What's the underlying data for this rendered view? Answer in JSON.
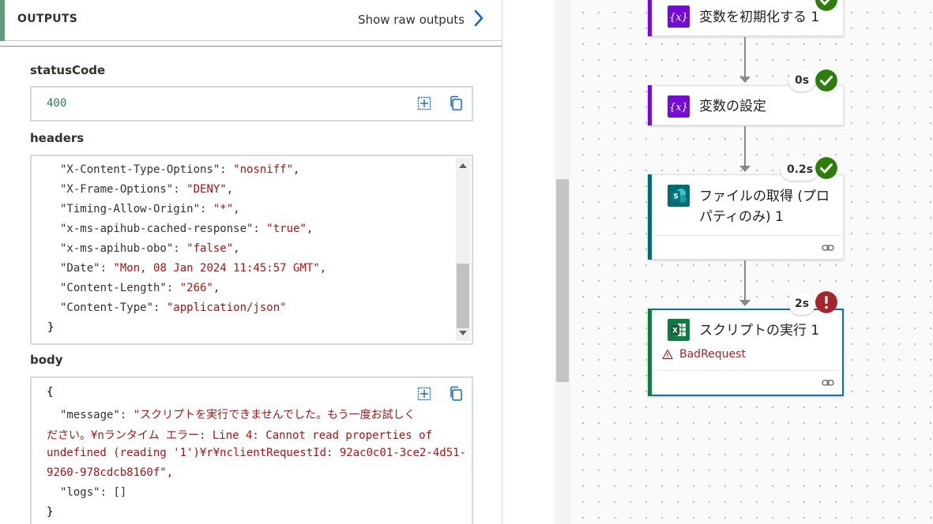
{
  "outputs": {
    "title": "OUTPUTS",
    "raw_link": "Show raw outputs"
  },
  "status_code": {
    "label": "statusCode",
    "value": "400"
  },
  "headers": {
    "label": "headers",
    "lines": [
      {
        "k": "\"X-Content-Type-Options\": ",
        "v": "\"nosniff\"",
        "t": ","
      },
      {
        "k": "\"X-Frame-Options\": ",
        "v": "\"DENY\"",
        "t": ","
      },
      {
        "k": "\"Timing-Allow-Origin\": ",
        "v": "\"*\"",
        "t": ","
      },
      {
        "k": "\"x-ms-apihub-cached-response\": ",
        "v": "\"true\"",
        "t": ","
      },
      {
        "k": "\"x-ms-apihub-obo\": ",
        "v": "\"false\"",
        "t": ","
      },
      {
        "k": "\"Date\": ",
        "v": "\"Mon, 08 Jan 2024 11:45:57 GMT\"",
        "t": ","
      },
      {
        "k": "\"Content-Length\": ",
        "v": "\"266\"",
        "t": ","
      },
      {
        "k": "\"Content-Type\": ",
        "v": "\"application/json\"",
        "t": ""
      }
    ],
    "closing": "}"
  },
  "body": {
    "label": "body",
    "open": "{",
    "message_key": "\"message\": ",
    "message_lines": [
      "\"スクリプトを実行できませんでした。もう一度お試しく",
      "ださい。¥nランタイム エラー: Line 4: Cannot read properties of",
      "undefined (reading '1')¥r¥nclientRequestId: 92ac0c01-3ce2-4d51-",
      "9260-978cdcb8160f\","
    ],
    "logs_key": "\"logs\": ",
    "logs_value": "[]",
    "close": "}"
  },
  "flow": {
    "steps": [
      {
        "title": "変数を初期化する 1",
        "time": "",
        "status": "success",
        "icon": "variable-icon",
        "color": "#770bd6"
      },
      {
        "title": "変数の設定",
        "time": "0s",
        "status": "success",
        "icon": "variable-icon",
        "color": "#770bd6"
      },
      {
        "title_line1": "ファイルの取得 (プロ",
        "title_line2": "パティのみ) 1",
        "time": "0.2s",
        "status": "success",
        "icon": "sharepoint-icon",
        "color": "#036c70"
      },
      {
        "title": "スクリプトの実行 1",
        "time": "2s",
        "status": "failed",
        "error": "BadRequest",
        "icon": "excel-icon",
        "color": "#107c41"
      }
    ]
  },
  "colors": {
    "success": "#2d7d0a",
    "error": "#a4262c",
    "selected_border": "#0f6cbd"
  }
}
